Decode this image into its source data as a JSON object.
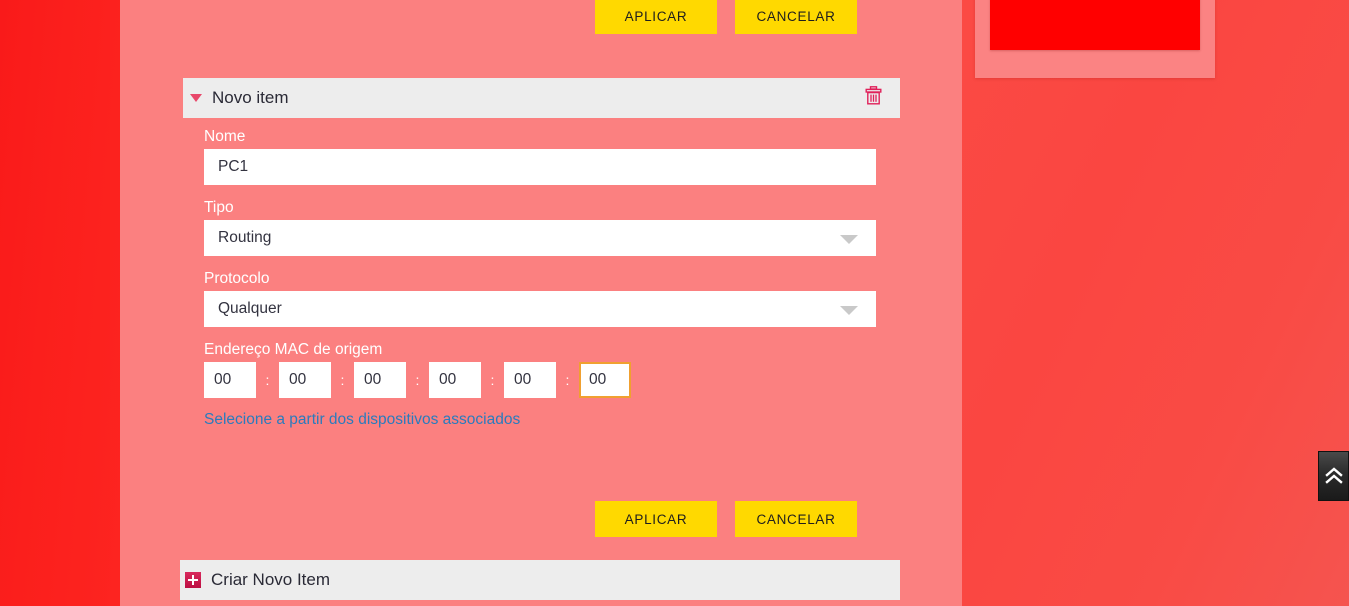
{
  "theme": {
    "panel_bg": "#fb8080",
    "rail_red": "#f91a1a",
    "accent_yellow": "#ffd900",
    "accordion_gray": "#ededed",
    "crimson": "#d8295c",
    "link_blue": "#2a7bbd",
    "focus_orange": "#f0a030",
    "red_block": "#ff0000"
  },
  "top_actions": {
    "apply_label": "APLICAR",
    "cancel_label": "CANCELAR"
  },
  "bottom_actions": {
    "apply_label": "APLICAR",
    "cancel_label": "CANCELAR"
  },
  "item_panel": {
    "title": "Novo item",
    "toggle_icon": "triangle-down-icon",
    "delete_icon": "trash-icon"
  },
  "create_panel": {
    "title": "Criar Novo Item",
    "icon": "plus-square-icon"
  },
  "form": {
    "name": {
      "label": "Nome",
      "value": "PC1",
      "placeholder": ""
    },
    "type": {
      "label": "Tipo",
      "value": "Routing"
    },
    "protocol": {
      "label": "Protocolo",
      "value": "Qualquer"
    },
    "mac": {
      "label": "Endereço MAC de origem",
      "octets": [
        "00",
        "00",
        "00",
        "00",
        "00",
        "00"
      ],
      "separator": ":",
      "focused_index": 5,
      "link_label": "Selecione a partir dos dispositivos associados"
    }
  },
  "scroll_top": {
    "icon": "double-chevron-up-icon"
  }
}
